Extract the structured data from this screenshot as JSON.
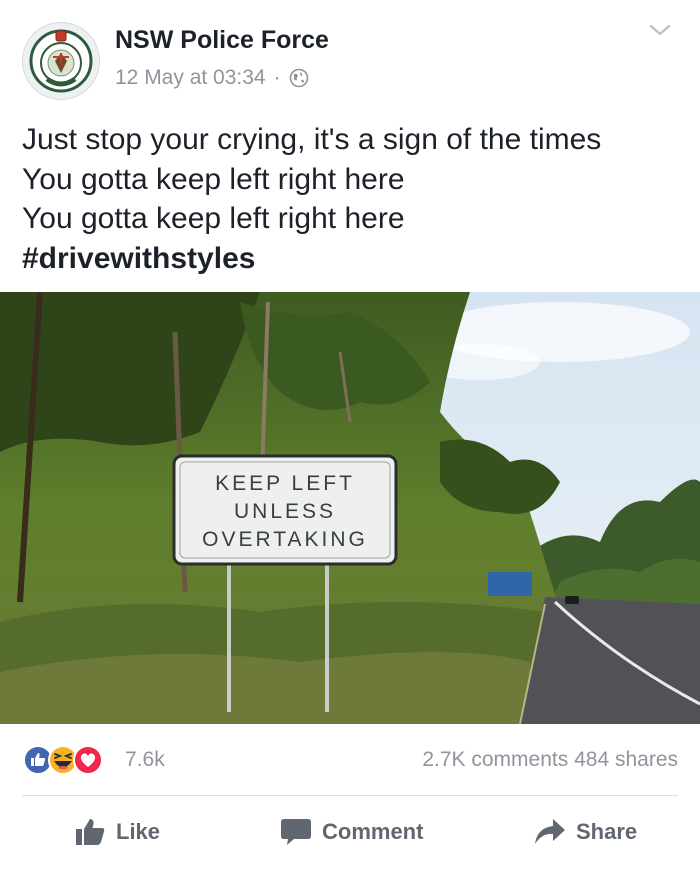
{
  "post": {
    "page_name": "NSW Police Force",
    "timestamp": "12 May at 03:34",
    "separator": "·",
    "privacy_icon": "globe-icon",
    "text_lines": [
      "Just stop your crying, it's a sign of the times",
      "You gotta keep left right here",
      "You gotta keep left right here"
    ],
    "hashtag": "#drivewithstyles"
  },
  "photo": {
    "sign_lines": [
      "KEEP LEFT",
      "UNLESS",
      "OVERTAKING"
    ]
  },
  "stats": {
    "reaction_icons": [
      "like-icon",
      "haha-icon",
      "love-icon"
    ],
    "reaction_count": "7.6k",
    "comments": "2.7K comments",
    "shares": "484 shares"
  },
  "actions": {
    "like": "Like",
    "comment": "Comment",
    "share": "Share"
  },
  "colors": {
    "like_blue": "#4267b2",
    "love_red": "#f0284a",
    "haha_yellow": "#f7b125",
    "muted_text": "#90949c",
    "action_text": "#606770"
  }
}
